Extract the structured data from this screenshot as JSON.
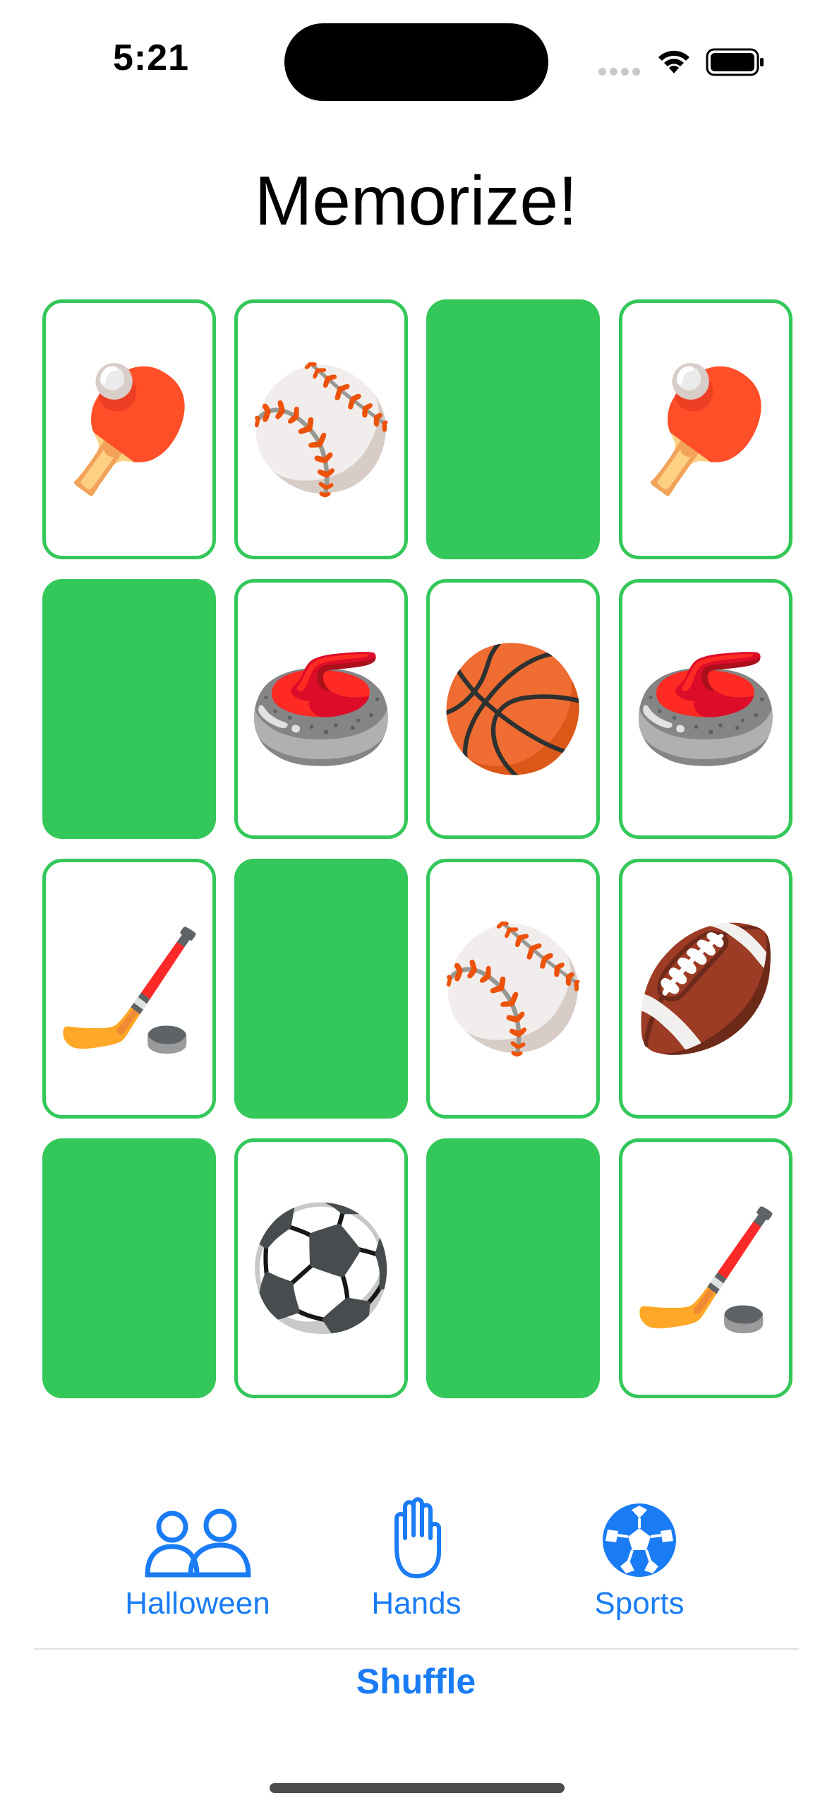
{
  "status_bar": {
    "time": "5:21"
  },
  "title": "Memorize!",
  "cards": [
    {
      "face_up": true,
      "emoji": "🏓",
      "icon": "ping-pong-icon"
    },
    {
      "face_up": true,
      "emoji": "⚾",
      "icon": "baseball-icon"
    },
    {
      "face_up": false,
      "emoji": "",
      "icon": ""
    },
    {
      "face_up": true,
      "emoji": "🏓",
      "icon": "ping-pong-icon"
    },
    {
      "face_up": false,
      "emoji": "",
      "icon": ""
    },
    {
      "face_up": true,
      "emoji": "🥌",
      "icon": "curling-stone-icon"
    },
    {
      "face_up": true,
      "emoji": "🏀",
      "icon": "basketball-icon"
    },
    {
      "face_up": true,
      "emoji": "🥌",
      "icon": "curling-stone-icon"
    },
    {
      "face_up": true,
      "emoji": "🏒",
      "icon": "hockey-stick-icon"
    },
    {
      "face_up": false,
      "emoji": "",
      "icon": ""
    },
    {
      "face_up": true,
      "emoji": "⚾",
      "icon": "baseball-icon"
    },
    {
      "face_up": true,
      "emoji": "🏈",
      "icon": "football-icon"
    },
    {
      "face_up": false,
      "emoji": "",
      "icon": ""
    },
    {
      "face_up": true,
      "emoji": "⚽",
      "icon": "soccer-ball-icon"
    },
    {
      "face_up": false,
      "emoji": "",
      "icon": ""
    },
    {
      "face_up": true,
      "emoji": "🏒",
      "icon": "hockey-stick-icon"
    }
  ],
  "themes": [
    {
      "label": "Halloween",
      "icon": "two-people-icon"
    },
    {
      "label": "Hands",
      "icon": "hand-raised-icon"
    },
    {
      "label": "Sports",
      "icon": "soccer-ball-icon"
    }
  ],
  "shuffle_label": "Shuffle",
  "colors": {
    "card_green": "#34c759",
    "accent_blue": "#1a7cf5"
  }
}
